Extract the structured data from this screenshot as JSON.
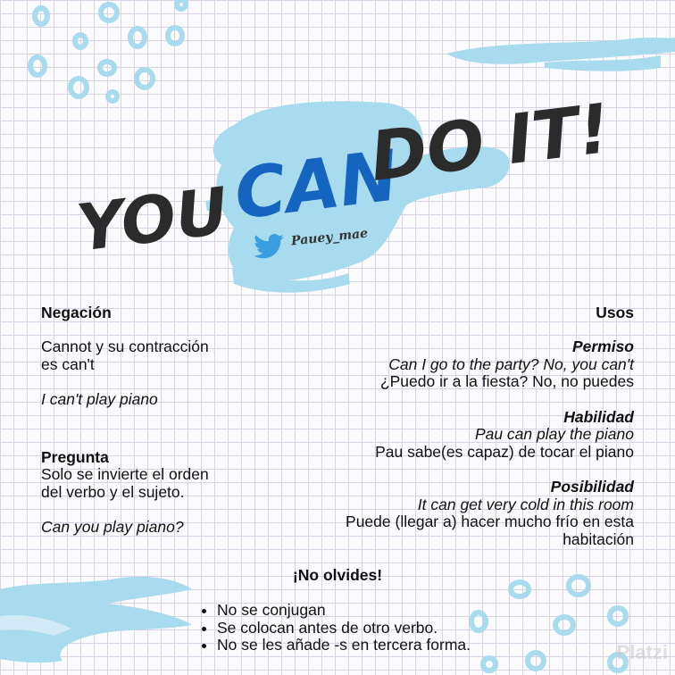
{
  "title": {
    "word1": "YOU",
    "word2": "CAN",
    "word3": "DO IT!",
    "handle": "Pauey_mae"
  },
  "colors": {
    "accent_blue": "#1565c0",
    "splash": "#a9dbee",
    "ink": "#2b2b2b"
  },
  "left": {
    "negacion_heading": "Negación",
    "negacion_line1": "Cannot y su contracción",
    "negacion_line2": "es can't",
    "negacion_example": "I can't play piano",
    "pregunta_heading": "Pregunta",
    "pregunta_line1": "Solo se invierte el orden",
    "pregunta_line2": "del verbo y el sujeto.",
    "pregunta_example": "Can you play piano?"
  },
  "right": {
    "heading": "Usos",
    "permiso_heading": "Permiso",
    "permiso_en": "Can I go to the party? No, you can't",
    "permiso_es": "¿Puedo ir a la fiesta? No, no puedes",
    "habilidad_heading": "Habilidad",
    "habilidad_en": "Pau can play the piano",
    "habilidad_es": "Pau sabe(es capaz) de tocar el piano",
    "posibilidad_heading": "Posibilidad",
    "posibilidad_en": "It can get very cold in this room",
    "posibilidad_es_1": "Puede (llegar a) hacer mucho frío en esta",
    "posibilidad_es_2": "habitación"
  },
  "reminder": {
    "heading": "¡No olvides!",
    "items": [
      "No se conjugan",
      "Se colocan antes de otro verbo.",
      "No se les añade -s en tercera forma."
    ]
  },
  "watermark": "Platzi",
  "icons": [
    "twitter-icon"
  ]
}
